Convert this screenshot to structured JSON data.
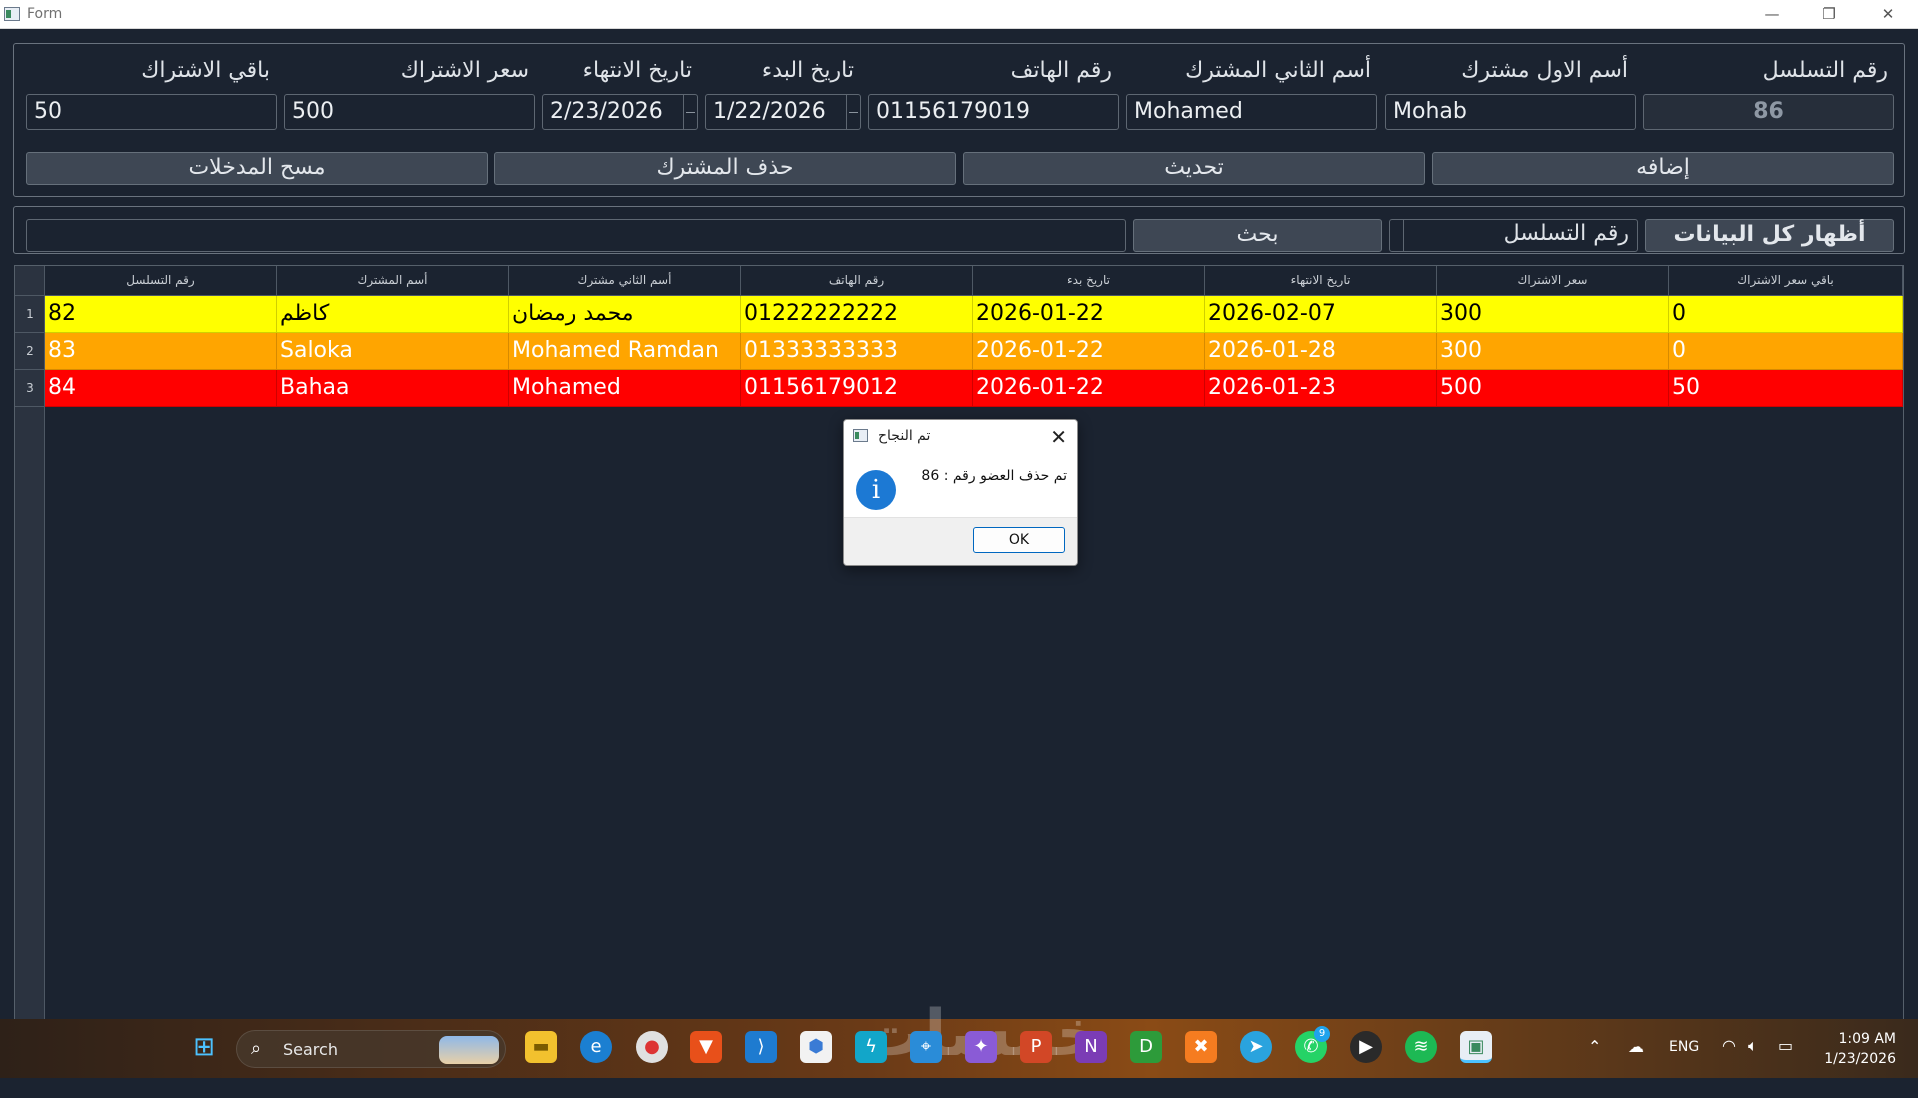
{
  "window": {
    "title": "Form",
    "minimize": "—",
    "restore": "❐",
    "close": "✕"
  },
  "form": {
    "labels": {
      "serial": "رقم التسلسل",
      "first_name": "أسم الاول مشترك",
      "second_name": "أسم الثاني المشترك",
      "phone": "رقم الهاتف",
      "start_date": "تاريخ البدء",
      "end_date": "تاريخ الانتهاء",
      "price": "سعر الاشتراك",
      "remaining": "باقي الاشتراك"
    },
    "values": {
      "serial": "86",
      "first_name": "Mohab",
      "second_name": "Mohamed",
      "phone": "01156179019",
      "start_date": "1/22/2026",
      "end_date": "2/23/2026",
      "price": "500",
      "remaining": "50"
    },
    "buttons": {
      "add": "إضافه",
      "update": "تحديث",
      "delete": "حذف المشترك",
      "clear": "مسح المدخلات"
    }
  },
  "search": {
    "show_all": "أظهار كل البيانات",
    "field_selected": "رقم التسلسل",
    "search_button": "بحث",
    "search_value": ""
  },
  "table": {
    "headers": [
      "رقم التسلسل",
      "أسم المشترك",
      "أسم الثاني مشترك",
      "رقم الهاتف",
      "تاريخ بدء",
      "تاريخ الانتهاء",
      "سعر الاشتراك",
      "باقي سعر الاشتراك"
    ],
    "rows": [
      {
        "index": "1",
        "color": "#ffff00",
        "cells": [
          "82",
          "كاظم",
          "محمد رمضان",
          "01222222222",
          "2026-01-22",
          "2026-02-07",
          "300",
          "0"
        ]
      },
      {
        "index": "2",
        "color": "#ffa500",
        "cells": [
          "83",
          "Saloka",
          "Mohamed Ramdan",
          "01333333333",
          "2026-01-22",
          "2026-01-28",
          "300",
          "0"
        ]
      },
      {
        "index": "3",
        "color": "#ff0000",
        "cells": [
          "84",
          "Bahaa",
          "Mohamed",
          "01156179012",
          "2026-01-22",
          "2026-01-23",
          "500",
          "50"
        ]
      }
    ]
  },
  "dialog": {
    "title": "تم النجاح",
    "message": "تم حذف العضو رقم : 86",
    "ok": "OK",
    "close": "✕",
    "icon": "i"
  },
  "taskbar": {
    "search_label": "Search",
    "language": "ENG",
    "time": "1:09 AM",
    "date": "1/23/2026",
    "whatsapp_badge": "9",
    "watermark": "خمسات",
    "icons": [
      "windows-start",
      "file-explorer",
      "edge",
      "chrome",
      "brave",
      "vscode",
      "app-cube",
      "app-bolt",
      "app-pin",
      "visual-studio",
      "powerpoint",
      "onenote",
      "app-d",
      "app-xampp",
      "telegram",
      "whatsapp",
      "media-player",
      "spotify",
      "form-app"
    ]
  },
  "colors": {
    "background": "#1b2330",
    "row_yellow": "#ffff00",
    "row_orange": "#ffa500",
    "row_red": "#ff0000",
    "info_blue": "#1c79d4"
  }
}
